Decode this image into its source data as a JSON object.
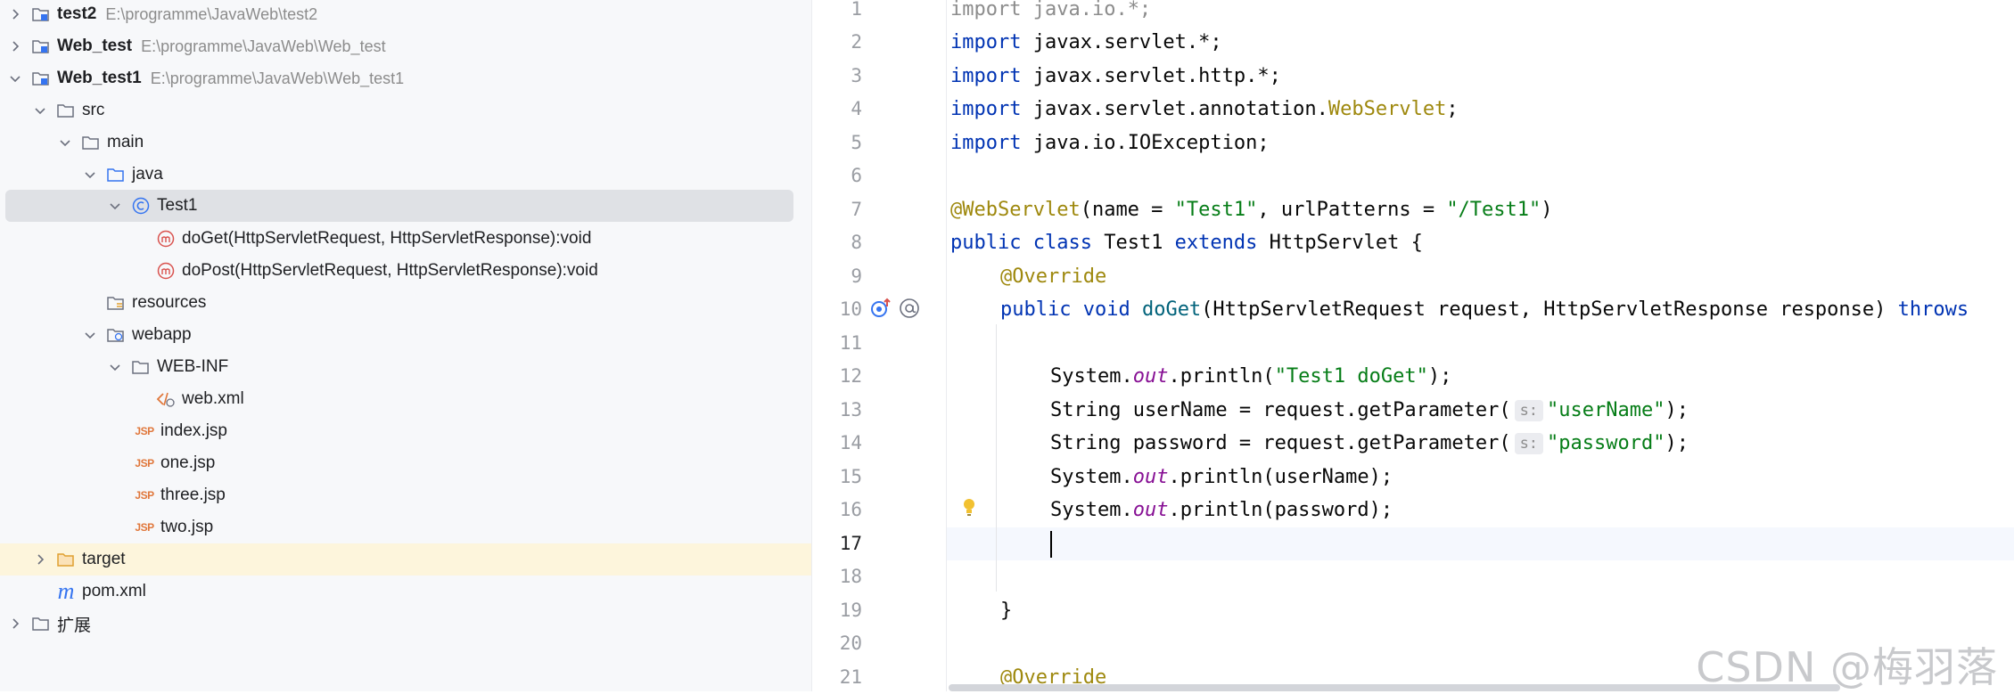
{
  "tree": {
    "items": [
      {
        "label": "test2",
        "path": "E:\\programme\\JavaWeb\\test2"
      },
      {
        "label": "Web_test",
        "path": "E:\\programme\\JavaWeb\\Web_test"
      },
      {
        "label": "Web_test1",
        "path": "E:\\programme\\JavaWeb\\Web_test1"
      },
      {
        "label": "src"
      },
      {
        "label": "main"
      },
      {
        "label": "java"
      },
      {
        "label": "Test1"
      },
      {
        "label": "doGet(HttpServletRequest, HttpServletResponse):void"
      },
      {
        "label": "doPost(HttpServletRequest, HttpServletResponse):void"
      },
      {
        "label": "resources"
      },
      {
        "label": "webapp"
      },
      {
        "label": "WEB-INF"
      },
      {
        "label": "web.xml"
      },
      {
        "label": "index.jsp"
      },
      {
        "label": "one.jsp"
      },
      {
        "label": "three.jsp"
      },
      {
        "label": "two.jsp"
      },
      {
        "label": "target"
      },
      {
        "label": "pom.xml"
      },
      {
        "label": "扩展"
      }
    ],
    "jsp_badge": "JSP",
    "pom_badge": "m"
  },
  "editor": {
    "line_numbers": [
      "1",
      "2",
      "3",
      "4",
      "5",
      "6",
      "7",
      "8",
      "9",
      "10",
      "11",
      "12",
      "13",
      "14",
      "15",
      "16",
      "17",
      "18",
      "19",
      "20",
      "21"
    ],
    "current_line": "17",
    "lines": {
      "l1": {
        "kw": "import",
        "rest": " java.io.*;"
      },
      "l2": {
        "kw": "import",
        "rest": " javax.servlet.*;"
      },
      "l3": {
        "kw": "import",
        "rest": " javax.servlet.http.*;"
      },
      "l4": {
        "kw": "import",
        "pre": " javax.servlet.annotation.",
        "ann": "WebServlet",
        "post": ";"
      },
      "l5": {
        "kw": "import",
        "rest": " java.io.IOException;"
      },
      "l7": {
        "ann": "@WebServlet",
        "a": "(name = ",
        "s1": "\"Test1\"",
        "b": ", urlPatterns = ",
        "s2": "\"/Test1\"",
        "c": ")"
      },
      "l8": {
        "kw1": "public class",
        "a": " Test1 ",
        "kw2": "extends",
        "b": " HttpServlet {"
      },
      "l9": {
        "ann": "@Override"
      },
      "l10": {
        "kw": "public void",
        "fn": "doGet",
        "rest": "(HttpServletRequest request, HttpServletResponse response) ",
        "kw2": "throws"
      },
      "l12": {
        "a": "System.",
        "fld": "out",
        "b": ".println(",
        "s": "\"Test1 doGet\"",
        "c": ");"
      },
      "l13": {
        "a": "String userName = request.getParameter(",
        "hint": "s:",
        "s": "\"userName\"",
        "c": ");"
      },
      "l14": {
        "a": "String password = request.getParameter(",
        "hint": "s:",
        "s": "\"password\"",
        "c": ");"
      },
      "l15": {
        "a": "System.",
        "fld": "out",
        "b": ".println(userName);"
      },
      "l16": {
        "a": "System.",
        "fld": "out",
        "b": ".println(password);"
      },
      "l19": {
        "a": "}"
      },
      "l21": {
        "ann": "@Override"
      }
    }
  },
  "watermark": "CSDN @梅羽落",
  "colors": {
    "keyword": "#0033b3",
    "annotation": "#9e880d",
    "string": "#067d17",
    "field": "#871094",
    "selection": "#dfe1e5",
    "highlight_row": "#fdf5dc",
    "method_icon": "#d9534f",
    "class_icon": "#3574f0",
    "jsp_icon": "#e0773b"
  }
}
